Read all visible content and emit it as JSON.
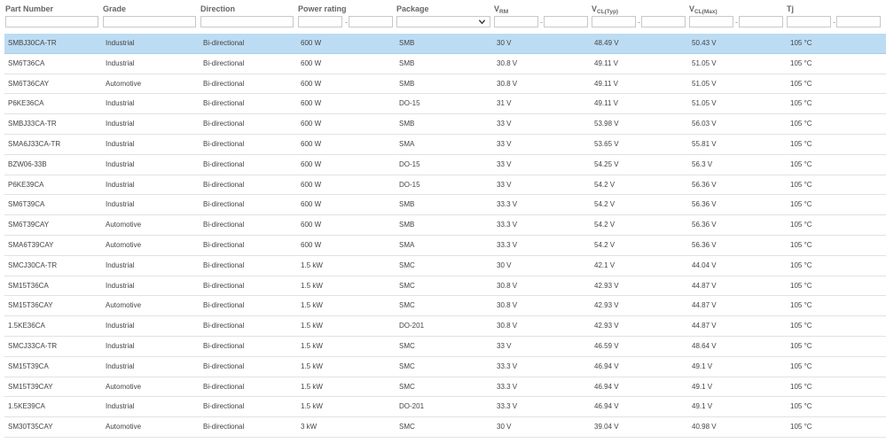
{
  "columns": [
    {
      "key": "part",
      "label": "Part Number"
    },
    {
      "key": "grade",
      "label": "Grade"
    },
    {
      "key": "direction",
      "label": "Direction"
    },
    {
      "key": "power",
      "label": "Power rating"
    },
    {
      "key": "package",
      "label": "Package"
    },
    {
      "key": "vrm",
      "label": "V",
      "sub": "RM"
    },
    {
      "key": "vcltyp",
      "label": "V",
      "sub": "CL(Typ)"
    },
    {
      "key": "vclmax",
      "label": "V",
      "sub": "CL(Max)"
    },
    {
      "key": "tj",
      "label": "Tj"
    }
  ],
  "filters": {
    "range_separator": "-",
    "package_selected": ""
  },
  "selected_row_index": 0,
  "rows": [
    {
      "part": "SMBJ30CA-TR",
      "grade": "Industrial",
      "direction": "Bi-directional",
      "power": "600 W",
      "package": "SMB",
      "vrm": "30 V",
      "vcltyp": "48.49 V",
      "vclmax": "50.43 V",
      "tj": "105 °C"
    },
    {
      "part": "SM6T36CA",
      "grade": "Industrial",
      "direction": "Bi-directional",
      "power": "600 W",
      "package": "SMB",
      "vrm": "30.8 V",
      "vcltyp": "49.11 V",
      "vclmax": "51.05 V",
      "tj": "105 °C"
    },
    {
      "part": "SM6T36CAY",
      "grade": "Automotive",
      "direction": "Bi-directional",
      "power": "600 W",
      "package": "SMB",
      "vrm": "30.8 V",
      "vcltyp": "49.11 V",
      "vclmax": "51.05 V",
      "tj": "105 °C"
    },
    {
      "part": "P6KE36CA",
      "grade": "Industrial",
      "direction": "Bi-directional",
      "power": "600 W",
      "package": "DO-15",
      "vrm": "31 V",
      "vcltyp": "49.11 V",
      "vclmax": "51.05 V",
      "tj": "105 °C"
    },
    {
      "part": "SMBJ33CA-TR",
      "grade": "Industrial",
      "direction": "Bi-directional",
      "power": "600 W",
      "package": "SMB",
      "vrm": "33 V",
      "vcltyp": "53.98 V",
      "vclmax": "56.03 V",
      "tj": "105 °C"
    },
    {
      "part": "SMA6J33CA-TR",
      "grade": "Industrial",
      "direction": "Bi-directional",
      "power": "600 W",
      "package": "SMA",
      "vrm": "33 V",
      "vcltyp": "53.65 V",
      "vclmax": "55.81 V",
      "tj": "105 °C"
    },
    {
      "part": "BZW06-33B",
      "grade": "Industrial",
      "direction": "Bi-directional",
      "power": "600 W",
      "package": "DO-15",
      "vrm": "33 V",
      "vcltyp": "54.25 V",
      "vclmax": "56.3 V",
      "tj": "105 °C"
    },
    {
      "part": "P6KE39CA",
      "grade": "Industrial",
      "direction": "Bi-directional",
      "power": "600 W",
      "package": "DO-15",
      "vrm": "33 V",
      "vcltyp": "54.2 V",
      "vclmax": "56.36 V",
      "tj": "105 °C"
    },
    {
      "part": "SM6T39CA",
      "grade": "Industrial",
      "direction": "Bi-directional",
      "power": "600 W",
      "package": "SMB",
      "vrm": "33.3 V",
      "vcltyp": "54.2 V",
      "vclmax": "56.36 V",
      "tj": "105 °C"
    },
    {
      "part": "SM6T39CAY",
      "grade": "Automotive",
      "direction": "Bi-directional",
      "power": "600 W",
      "package": "SMB",
      "vrm": "33.3 V",
      "vcltyp": "54.2 V",
      "vclmax": "56.36 V",
      "tj": "105 °C"
    },
    {
      "part": "SMA6T39CAY",
      "grade": "Automotive",
      "direction": "Bi-directional",
      "power": "600 W",
      "package": "SMA",
      "vrm": "33.3 V",
      "vcltyp": "54.2 V",
      "vclmax": "56.36 V",
      "tj": "105 °C"
    },
    {
      "part": "SMCJ30CA-TR",
      "grade": "Industrial",
      "direction": "Bi-directional",
      "power": "1.5 kW",
      "package": "SMC",
      "vrm": "30 V",
      "vcltyp": "42.1 V",
      "vclmax": "44.04 V",
      "tj": "105 °C"
    },
    {
      "part": "SM15T36CA",
      "grade": "Industrial",
      "direction": "Bi-directional",
      "power": "1.5 kW",
      "package": "SMC",
      "vrm": "30.8 V",
      "vcltyp": "42.93 V",
      "vclmax": "44.87 V",
      "tj": "105 °C"
    },
    {
      "part": "SM15T36CAY",
      "grade": "Automotive",
      "direction": "Bi-directional",
      "power": "1.5 kW",
      "package": "SMC",
      "vrm": "30.8 V",
      "vcltyp": "42.93 V",
      "vclmax": "44.87 V",
      "tj": "105 °C"
    },
    {
      "part": "1.5KE36CA",
      "grade": "Industrial",
      "direction": "Bi-directional",
      "power": "1.5 kW",
      "package": "DO-201",
      "vrm": "30.8 V",
      "vcltyp": "42.93 V",
      "vclmax": "44.87 V",
      "tj": "105 °C"
    },
    {
      "part": "SMCJ33CA-TR",
      "grade": "Industrial",
      "direction": "Bi-directional",
      "power": "1.5 kW",
      "package": "SMC",
      "vrm": "33 V",
      "vcltyp": "46.59 V",
      "vclmax": "48.64 V",
      "tj": "105 °C"
    },
    {
      "part": "SM15T39CA",
      "grade": "Industrial",
      "direction": "Bi-directional",
      "power": "1.5 kW",
      "package": "SMC",
      "vrm": "33.3 V",
      "vcltyp": "46.94 V",
      "vclmax": "49.1 V",
      "tj": "105 °C"
    },
    {
      "part": "SM15T39CAY",
      "grade": "Automotive",
      "direction": "Bi-directional",
      "power": "1.5 kW",
      "package": "SMC",
      "vrm": "33.3 V",
      "vcltyp": "46.94 V",
      "vclmax": "49.1 V",
      "tj": "105 °C"
    },
    {
      "part": "1.5KE39CA",
      "grade": "Industrial",
      "direction": "Bi-directional",
      "power": "1.5 kW",
      "package": "DO-201",
      "vrm": "33.3 V",
      "vcltyp": "46.94 V",
      "vclmax": "49.1 V",
      "tj": "105 °C"
    },
    {
      "part": "SM30T35CAY",
      "grade": "Automotive",
      "direction": "Bi-directional",
      "power": "3 kW",
      "package": "SMC",
      "vrm": "30 V",
      "vcltyp": "39.04 V",
      "vclmax": "40.98 V",
      "tj": "105 °C"
    }
  ]
}
